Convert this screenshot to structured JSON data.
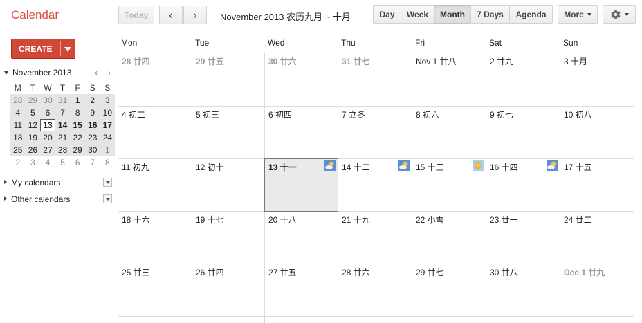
{
  "app": {
    "title": "Calendar"
  },
  "toolbar": {
    "today": "Today",
    "prev": "‹",
    "next": "›",
    "range": "November 2013 农历九月 ~ 十月",
    "views": [
      "Day",
      "Week",
      "Month",
      "7 Days",
      "Agenda"
    ],
    "active_view": "Month",
    "more": "More"
  },
  "create": {
    "label": "CREATE",
    "arrow": "▼"
  },
  "mini": {
    "title": "November 2013",
    "prev": "‹",
    "next": "›",
    "dow": [
      "M",
      "T",
      "W",
      "T",
      "F",
      "S",
      "S"
    ],
    "weeks": [
      [
        "28",
        "29",
        "30",
        "31",
        "1",
        "2",
        "3"
      ],
      [
        "4",
        "5",
        "6",
        "7",
        "8",
        "9",
        "10"
      ],
      [
        "11",
        "12",
        "13",
        "14",
        "15",
        "16",
        "17"
      ],
      [
        "18",
        "19",
        "20",
        "21",
        "22",
        "23",
        "24"
      ],
      [
        "25",
        "26",
        "27",
        "28",
        "29",
        "30",
        "1"
      ],
      [
        "2",
        "3",
        "4",
        "5",
        "6",
        "7",
        "8"
      ]
    ]
  },
  "sidebar": {
    "my_calendars": "My calendars",
    "other_calendars": "Other calendars"
  },
  "month": {
    "days_of_week": [
      "Mon",
      "Tue",
      "Wed",
      "Thu",
      "Fri",
      "Sat",
      "Sun"
    ],
    "weeks": [
      [
        "28 廿四",
        "29 廿五",
        "30 廿六",
        "31 廿七",
        "Nov 1 廿八",
        "2 廿九",
        "3 十月"
      ],
      [
        "4 初二",
        "5 初三",
        "6 初四",
        "7 立冬",
        "8 初六",
        "9 初七",
        "10 初八"
      ],
      [
        "11 初九",
        "12 初十",
        "13 十一",
        "14 十二",
        "15 十三",
        "16 十四",
        "17 十五"
      ],
      [
        "18 十六",
        "19 十七",
        "20 十八",
        "21 十九",
        "22 小雪",
        "23 廿一",
        "24 廿二"
      ],
      [
        "25 廿三",
        "26 廿四",
        "27 廿五",
        "28 廿六",
        "29 廿七",
        "30 廿八",
        "Dec 1 廿九"
      ]
    ]
  },
  "colors": {
    "accent": "#dd4b39",
    "create_bg": "#d14836",
    "today_bg": "#eaeaea"
  }
}
